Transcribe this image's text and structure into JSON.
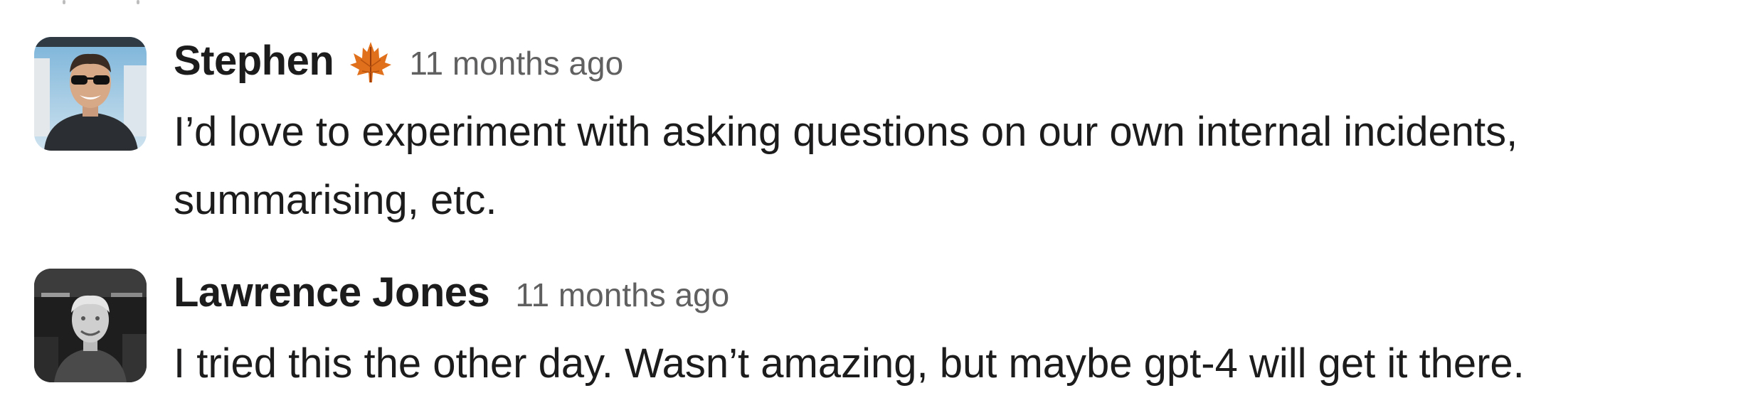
{
  "messages": [
    {
      "author": "Stephen",
      "status_emoji": "maple-leaf-icon",
      "timestamp": "11 months ago",
      "lines": [
        "I’d love to experiment with asking questions on our own internal incidents,",
        "summarising, etc."
      ]
    },
    {
      "author": "Lawrence Jones",
      "timestamp": "11 months ago",
      "lines": [
        "I tried this the other day. Wasn’t amazing, but maybe gpt-4 will get it there."
      ]
    }
  ],
  "colors": {
    "text": "#1d1c1d",
    "timestamp": "#616061",
    "background": "#ffffff"
  }
}
